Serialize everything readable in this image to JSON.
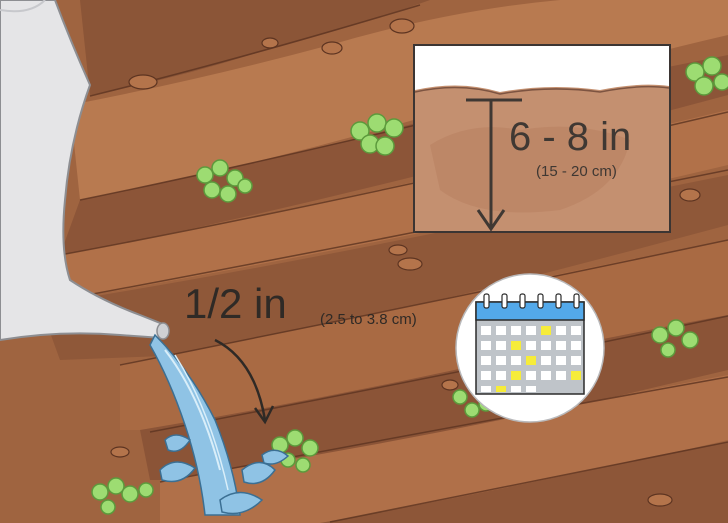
{
  "illustration": {
    "watering_amount": "1/2 in",
    "watering_amount_metric": "(2.5 to 3.8 cm)",
    "soil_depth": "6 - 8 in",
    "soil_depth_metric": "(15 - 20 cm)",
    "icons": [
      "watering-can-icon",
      "water-stream-icon",
      "seedling-icon",
      "calendar-icon",
      "depth-arrow-icon"
    ]
  },
  "colors": {
    "soil_dark": "#8c5638",
    "soil_mid": "#a86b47",
    "soil_light": "#c18358",
    "inset_sky": "#ffffff",
    "inset_soil": "#c49070",
    "leaf_green": "#9ddc72",
    "leaf_dark": "#5c9a3c",
    "calendar_blue": "#53a9ea",
    "calendar_gray": "#bfc4c9",
    "calendar_yellow": "#f6ec3a",
    "water_blue": "#8fc3e5",
    "can_gray": "#e5e5e7"
  }
}
